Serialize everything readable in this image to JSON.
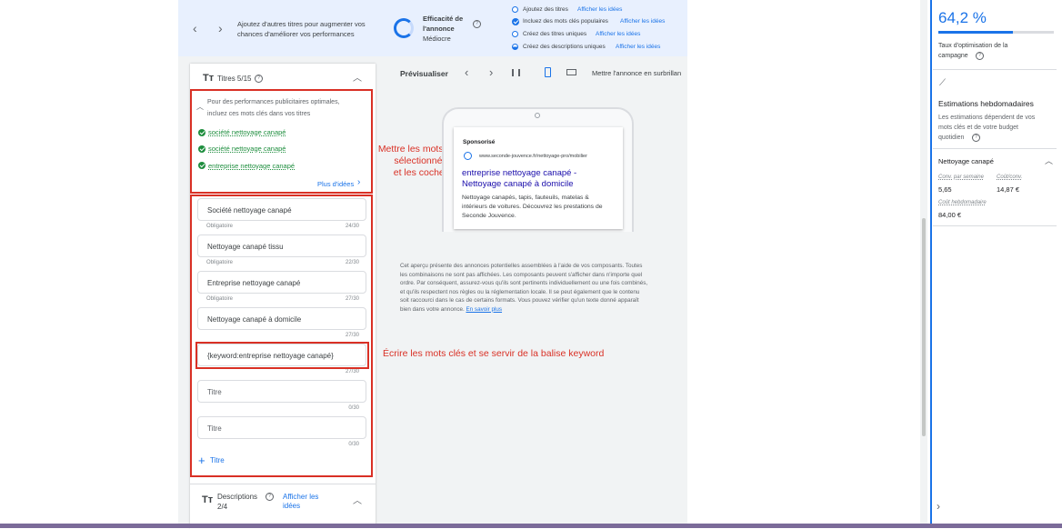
{
  "banner": {
    "message": "Ajoutez d'autres titres pour augmenter vos chances d'améliorer vos performances",
    "strength_label_1": "Efficacité de",
    "strength_label_2": "l'annonce",
    "strength_value": "Médiocre",
    "suggestions": [
      {
        "text": "Ajoutez des titres",
        "link": "Afficher les idées",
        "state": "empty"
      },
      {
        "text": "Incluez des mots clés populaires",
        "link": "Afficher les idées",
        "state": "done"
      },
      {
        "text": "Créez des titres uniques",
        "link": "Afficher les idées",
        "state": "empty"
      },
      {
        "text": "Créez des descriptions uniques",
        "link": "Afficher les idées",
        "state": "half"
      }
    ]
  },
  "headlines": {
    "title": "Titres 5/15",
    "suggest_line1": "Pour des performances publicitaires optimales,",
    "suggest_line2": "incluez ces mots clés dans vos titres",
    "keywords": [
      "société nettoyage canapé",
      "société nettoyage canapé",
      "entreprise nettoyage canapé"
    ],
    "more_ideas": "Plus d'idées",
    "fields": [
      {
        "value": "Société nettoyage canapé",
        "sub": "Obligatoire",
        "count": "24/30"
      },
      {
        "value": "Nettoyage canapé tissu",
        "sub": "Obligatoire",
        "count": "22/30"
      },
      {
        "value": "Entreprise nettoyage canapé",
        "sub": "Obligatoire",
        "count": "27/30"
      },
      {
        "value": "Nettoyage canapé à domicile",
        "sub": "",
        "count": "27/30"
      },
      {
        "value": "{keyword:entreprise nettoyage canapé}",
        "sub": "",
        "count": "27/30"
      },
      {
        "value": "Titre",
        "sub": "",
        "count": "0/30"
      },
      {
        "value": "Titre",
        "sub": "",
        "count": "0/30"
      }
    ],
    "add_label": "Titre"
  },
  "descriptions": {
    "title": "Descriptions",
    "count": "2/4",
    "link_1": "Afficher les",
    "link_2": "idées"
  },
  "preview": {
    "title": "Prévisualiser",
    "highlight_label": "Mettre l'annonce en surbrillan",
    "sponsored": "Sponsorisé",
    "url": "www.seconde-jouvence.fr/nettoyage-pro/mobilier",
    "headline_1": "entreprise nettoyage canapé -",
    "headline_2": "Nettoyage canapé à domicile",
    "desc_1": "Nettoyage canapés, tapis, fauteuils, matelas &",
    "desc_2": "intérieurs de voitures. Découvrez les prestations de",
    "desc_3": "Seconde Jouvence.",
    "disclaimer": [
      "Cet aperçu présente des annonces potentielles assemblées à l'aide de vos composants. Toutes",
      "les combinaisons ne sont pas affichées. Les composants peuvent s'afficher dans n'importe quel",
      "ordre. Par conséquent, assurez-vous qu'ils sont pertinents individuellement ou une fois combinés,",
      "et qu'ils respectent nos règles ou la réglementation locale. Il se peut également que le contenu",
      "soit raccourci dans le cas de certains formats. Vous pouvez vérifier qu'un texte donné apparaît"
    ],
    "disclaimer_last": "bien dans votre annonce.",
    "learn_more": "En savoir plus"
  },
  "annotations": {
    "note_1_line1": "Mettre les mots clés",
    "note_1_line2": "sélectionnés",
    "note_1_line3": "et les cocher",
    "note_2": "Écrire les mots clés et se servir de la balise keyword"
  },
  "right_panel": {
    "score": "64,2 %",
    "score_fraction": 0.642,
    "score_label_1": "Taux d'optimisation de la",
    "score_label_2": "campagne",
    "weekly_title": "Estimations hebdomadaires",
    "weekly_desc_1": "Les estimations dépendent de vos",
    "weekly_desc_2": "mots clés et de votre budget",
    "weekly_desc_3": "quotidien",
    "group_name": "Nettoyage canapé",
    "metric_1_label": "Conv. par semaine",
    "metric_1_value": "5,65",
    "metric_2_label": "Coût/conv.",
    "metric_2_value": "14,87 €",
    "metric_3_label": "Coût hebdomadaire",
    "metric_3_value": "84,00 €"
  },
  "colors": {
    "accent": "#1a73e8",
    "annotation": "#d93025",
    "success": "#1e8e3e"
  }
}
